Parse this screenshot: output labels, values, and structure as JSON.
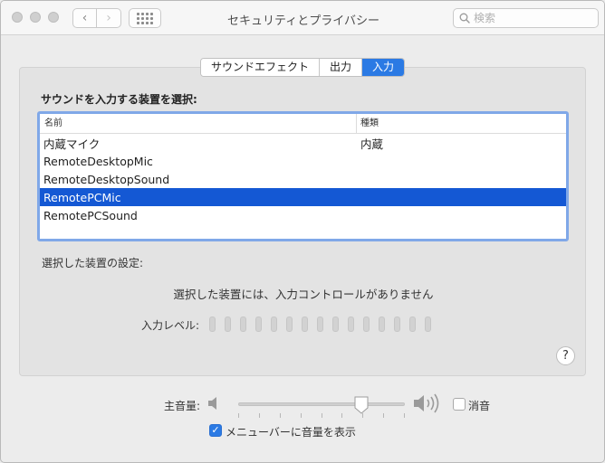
{
  "window": {
    "title": "セキュリティとプライバシー",
    "search_placeholder": "検索"
  },
  "tabs": [
    {
      "label": "サウンドエフェクト",
      "active": false
    },
    {
      "label": "出力",
      "active": false
    },
    {
      "label": "入力",
      "active": true
    }
  ],
  "input": {
    "section_label": "サウンドを入力する装置を選択:",
    "columns": {
      "name": "名前",
      "type": "種類"
    },
    "devices": [
      {
        "name": "内蔵マイク",
        "type": "内蔵",
        "selected": false
      },
      {
        "name": "RemoteDesktopMic",
        "type": "",
        "selected": false
      },
      {
        "name": "RemoteDesktopSound",
        "type": "",
        "selected": false
      },
      {
        "name": "RemotePCMic",
        "type": "",
        "selected": true
      },
      {
        "name": "RemotePCSound",
        "type": "",
        "selected": false
      }
    ],
    "settings_label": "選択した装置の設定:",
    "no_controls_text": "選択した装置には、入力コントロールがありません",
    "level_label": "入力レベル:",
    "level_bar_count": 15,
    "help": "?"
  },
  "volume": {
    "label": "主音量:",
    "level": 0.74,
    "tick_count": 9,
    "mute_label": "消音",
    "mute_checked": false,
    "menubar_label": "メニューバーに音量を表示",
    "menubar_checked": true
  },
  "colors": {
    "accent": "#2b7ae4",
    "selection": "#1458d4",
    "table_focus_ring": "#80a8e8"
  }
}
